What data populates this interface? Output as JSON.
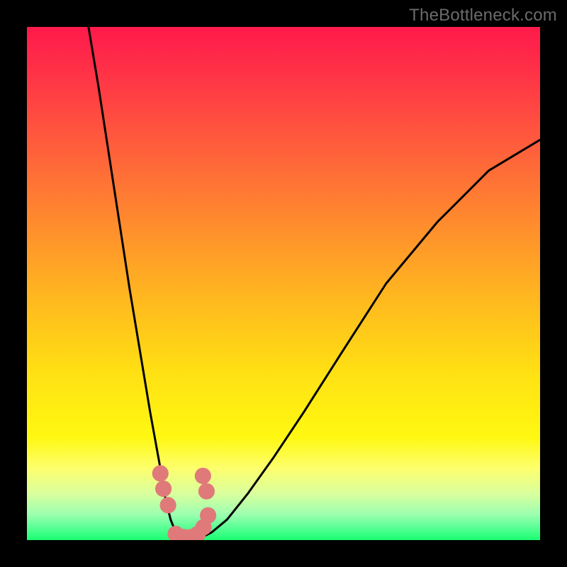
{
  "watermark": "TheBottleneck.com",
  "chart_data": {
    "type": "line",
    "title": "",
    "xlabel": "",
    "ylabel": "",
    "xlim": [
      0,
      100
    ],
    "ylim": [
      0,
      100
    ],
    "grid": false,
    "legend": false,
    "background_gradient": {
      "top_color": "#ff1a4b",
      "mid_color": "#ffe213",
      "bottom_color": "#1aff72",
      "description": "vertical gradient red → yellow → green inside black frame"
    },
    "series": [
      {
        "name": "curve-left",
        "description": "steep descending branch entering from top and reaching the valley floor",
        "x": [
          12,
          14,
          16,
          18,
          20,
          22,
          24,
          26,
          27,
          28,
          29,
          30
        ],
        "y": [
          100,
          88,
          75,
          62,
          49,
          37,
          25,
          14,
          8,
          4,
          1.5,
          0.5
        ],
        "color": "#000000"
      },
      {
        "name": "curve-right",
        "description": "ascending branch rising from the valley toward the upper right",
        "x": [
          34,
          36,
          39,
          43,
          48,
          54,
          61,
          70,
          80,
          90,
          100
        ],
        "y": [
          0.5,
          1.5,
          4,
          9,
          16,
          25,
          36,
          50,
          62,
          72,
          78
        ],
        "color": "#000000"
      },
      {
        "name": "valley-points",
        "description": "pink dots clustered along the bottom of the V shape",
        "type": "scatter",
        "color": "#e07a7a",
        "x": [
          26.0,
          26.6,
          27.5,
          29.0,
          30.5,
          32.0,
          33.3,
          34.4,
          35.3,
          35.0,
          34.3
        ],
        "y": [
          13.0,
          10.0,
          6.8,
          1.2,
          0.6,
          0.6,
          1.2,
          2.5,
          4.8,
          9.5,
          12.5
        ],
        "marker_radius": 1.6
      }
    ]
  }
}
